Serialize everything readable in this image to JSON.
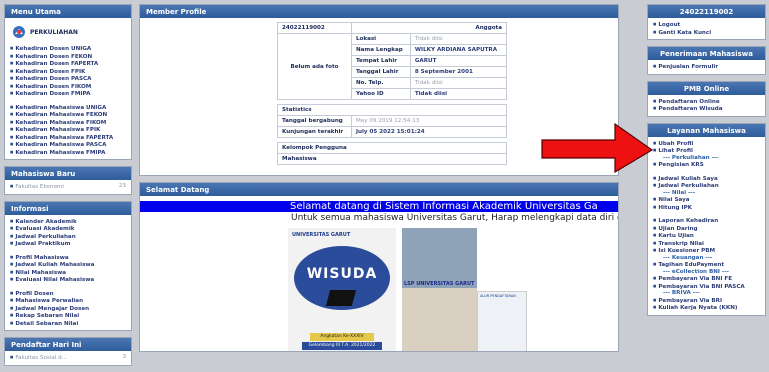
{
  "left": {
    "menu": {
      "title": "Menu Utama",
      "logo": "PERKULIAHAN",
      "dosen": [
        "Kehadiran Dosen UNIGA",
        "Kehadiran Dosen FEKON",
        "Kehadiran Dosen FAPERTA",
        "Kehadiran Dosen FPIK",
        "Kehadiran Dosen PASCA",
        "Kehadiran Dosen FIKOM",
        "Kehadiran Dosen FMIPA"
      ],
      "mhs": [
        "Kehadiran Mahasiswa UNIGA",
        "Kehadiran Mahasiswa FEKON",
        "Kehadiran Mahasiswa FIKOM",
        "Kehadiran Mahasiswa FPIK",
        "Kehadiran Mahasiswa FAPERTA",
        "Kehadiran Mahasiswa PASCA",
        "Kehadiran Mahasiswa FMIPA"
      ]
    },
    "baru": {
      "title": "Mahasiswa Baru",
      "item": "Fakultas Ekonomi",
      "count": "23"
    },
    "info": {
      "title": "Informasi",
      "g1": [
        "Kalender Akademik",
        "Evaluasi Akademik",
        "Jadwal Perkuliahan",
        "Jadwal Praktikum"
      ],
      "g2": [
        "Profil Mahasiswa",
        "Jadwal Kuliah Mahasiswa",
        "Nilai Mahasiswa",
        "Evaluasi Nilai Mahasiswa"
      ],
      "g3": [
        "Profil Dosen",
        "Mahasiswa Perwalian",
        "Jadwal Mengajar Dosen",
        "Rekap Sebaran Nilai",
        "Detail Sebaran Nilai"
      ]
    },
    "daftar": {
      "title": "Pendaftar Hari Ini",
      "item": "Fakultas Sosial d...",
      "count": "3"
    }
  },
  "profile": {
    "title": "Member Profile",
    "id": "24022119002",
    "role": "Anggota",
    "photo": "Belum ada foto",
    "rows": [
      [
        "Lokasi",
        "Tidak diisi"
      ],
      [
        "Nama Lengkap",
        "WILKY ARDIANA SAPUTRA"
      ],
      [
        "Tempat Lahir",
        "GARUT"
      ],
      [
        "Tanggal Lahir",
        "8 September 2001"
      ],
      [
        "No. Telp.",
        "Tidak diisi"
      ],
      [
        "Yahoo ID",
        "Tidak diisi"
      ]
    ],
    "stats": "Statistics",
    "joined_label": "Tanggal bergabung",
    "joined": "May 09 2019 12:54:13",
    "visit_label": "Kunjungan terakhir",
    "visit": "July 05 2022 15:01:24",
    "group_label": "Kelompok Pengguna",
    "group": "Mahasiswa"
  },
  "welcome": {
    "title": "Selamat Datang",
    "marquee": "Selamat datang di Sistem Informasi Akademik Universitas Ga",
    "sub": "Untuk semua mahasiswa Universitas Garut, Harap melengkapi data diri di Si",
    "banner_brand": "UNIVERSITAS GARUT",
    "banner_title": "WISUDA",
    "banner_line1": "Angkatan Ke-XXXIV",
    "banner_line2": "Gelombang III T.A. 2021/2022",
    "banner2_text": "LSP UNIVERSITAS GARUT",
    "banner2_caption": "ALUR PENDAFTARAN"
  },
  "right": {
    "user": {
      "title": "24022119002",
      "items": [
        "Logout",
        "Ganti Kata Kunci"
      ]
    },
    "penerimaan": {
      "title": "Penerimaan Mahasiswa Baru",
      "items": [
        "Penjualan Formulir"
      ]
    },
    "pmb": {
      "title": "PMB Online",
      "items": [
        "Pendaftaran Online",
        "Pendaftaran Wisuda"
      ]
    },
    "layanan": {
      "title": "Layanan Mahasiswa",
      "g1": [
        "Ubah Profil",
        "Lihat Profil"
      ],
      "sep1": "--- Perkuliahan ---",
      "g2": [
        "Pengisian KRS"
      ],
      "g3": [
        "Jadwal Kuliah Saya",
        "Jadwal Perkuliahan"
      ],
      "sep2": "--- Nilai ---",
      "g4": [
        "Nilai Saya",
        "Hitung IPK"
      ],
      "g5": [
        "Laporan Kehadiran",
        "Ujian Daring",
        "Kartu Ujian",
        "Transkrip Nilai",
        "Isi Kuesioner PBM"
      ],
      "sep3": "--- Keuangan ---",
      "g6": [
        "Tagihan EduPayment"
      ],
      "sep4": "--- eCollection BNI ---",
      "g7": [
        "Pembayaran Via BNI FE",
        "Pembayaran Via BNI PASCA"
      ],
      "sep5": "--- BRIVA ---",
      "g8": [
        "Pembayaran Via BRI",
        "Kuliah Kerja Nyata (KKN)"
      ]
    }
  },
  "colors": {
    "header": "#3a68a8",
    "marquee": "#0000ee",
    "arrow": "#ee1111"
  }
}
